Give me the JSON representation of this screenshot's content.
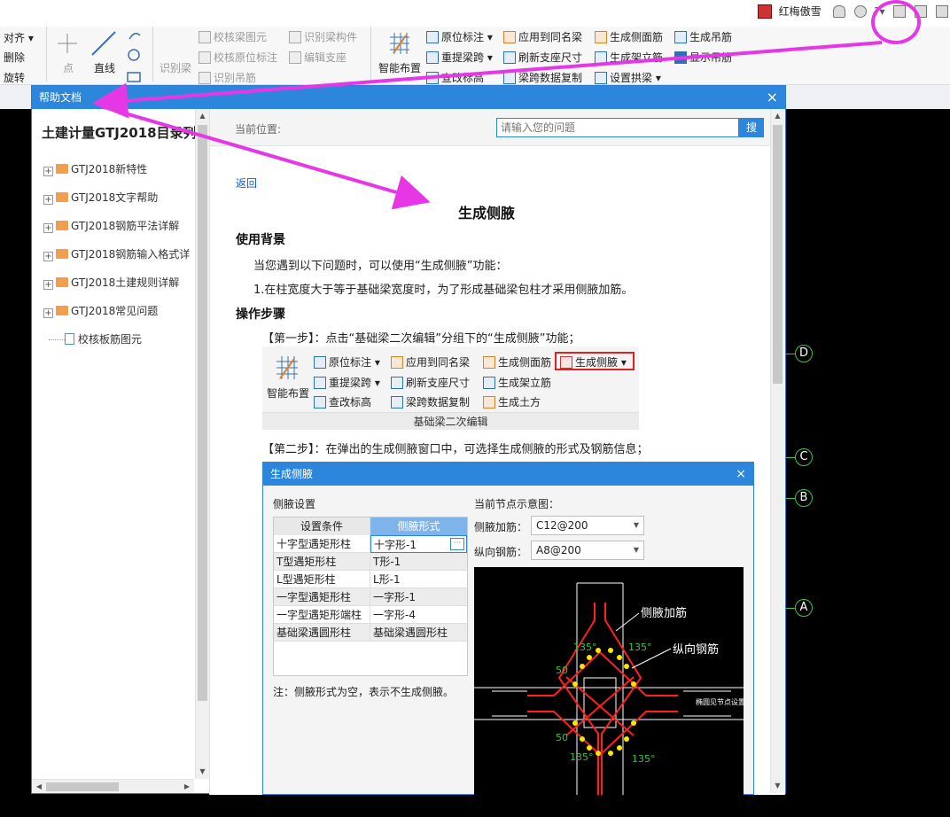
{
  "ribbon": {
    "left_items": [
      "对齐",
      "删除",
      "旋转"
    ],
    "draw_tools": {
      "point": "点",
      "line": "直线"
    },
    "identify": {
      "beam": "识别梁",
      "check_beam": "校核梁图元",
      "check_origin": "校核原位标注",
      "identify_hanger": "识别吊筋",
      "identify_beam_part": "识别梁构件",
      "edit_support": "编辑支座"
    },
    "smart_layout": "智能布置",
    "commands": {
      "origin_mark": "原位标注",
      "apply_same": "应用到同名梁",
      "gen_side": "生成侧面筋",
      "gen_hanger": "生成吊筋",
      "re_span": "重提梁跨",
      "refresh_support": "刷新支座尺寸",
      "gen_erect": "生成架立筋",
      "show_hanger": "显示吊筋",
      "change_elev": "查改标高",
      "span_copy": "梁跨数据复制",
      "set_arch": "设置拱梁"
    }
  },
  "user": {
    "name": "红梅傲雪",
    "help_icon": "question-icon"
  },
  "help_window": {
    "title": "帮助文档",
    "tree_title": "土建计量GTJ2018目录列",
    "tree": [
      {
        "label": "GTJ2018新特性",
        "type": "folder"
      },
      {
        "label": "GTJ2018文字帮助",
        "type": "folder"
      },
      {
        "label": "GTJ2018钢筋平法详解",
        "type": "folder"
      },
      {
        "label": "GTJ2018钢筋输入格式详",
        "type": "folder"
      },
      {
        "label": "GTJ2018土建规则详解",
        "type": "folder"
      },
      {
        "label": "GTJ2018常见问题",
        "type": "folder"
      },
      {
        "label": "校核板筋图元",
        "type": "doc"
      }
    ],
    "location_label": "当前位置:",
    "search_placeholder": "请输入您的问题",
    "search_button": "搜",
    "back": "返回",
    "doc": {
      "title": "生成侧腋",
      "bg_heading": "使用背景",
      "bg_intro": "当您遇到以下问题时，可以使用“生成侧腋”功能：",
      "bg_item1": "1.在柱宽度大于等于基础梁宽度时，为了形成基础梁包柱才采用侧腋加筋。",
      "steps_heading": "操作步骤",
      "step1": "【第一步】：点击“基础梁二次编辑”分组下的“生成侧腋”功能；",
      "step2": "【第二步】：在弹出的生成侧腋窗口中，可选择生成侧腋的形式及钢筋信息；"
    },
    "doc_toolbar": {
      "smart_layout": "智能布置",
      "origin_mark": "原位标注",
      "apply_same": "应用到同名梁",
      "gen_side": "生成侧面筋",
      "gen_haunch": "生成侧腋",
      "re_span": "重提梁跨",
      "refresh_support": "刷新支座尺寸",
      "gen_erect": "生成架立筋",
      "change_elev": "查改标高",
      "span_copy": "梁跨数据复制",
      "gen_earth": "生成土方",
      "group": "基础梁二次编辑"
    },
    "dialog": {
      "title": "生成侧腋",
      "section_left": "侧腋设置",
      "section_right": "当前节点示意图：",
      "col1": "设置条件",
      "col2": "侧腋形式",
      "rows": [
        {
          "cond": "十字型遇矩形柱",
          "form": "十字形-1"
        },
        {
          "cond": "T型遇矩形柱",
          "form": "T形-1"
        },
        {
          "cond": "L型遇矩形柱",
          "form": "L形-1"
        },
        {
          "cond": "一字型遇矩形柱",
          "form": "一字形-1"
        },
        {
          "cond": "一字型遇矩形端柱",
          "form": "一字形-4"
        },
        {
          "cond": "基础梁遇圆形柱",
          "form": "基础梁遇圆形柱"
        }
      ],
      "note": "注：侧腋形式为空，表示不生成侧腋。",
      "haunch_bar_label": "侧腋加筋：",
      "haunch_bar_value": "C12@200",
      "long_bar_label": "纵向钢筋：",
      "long_bar_value": "A8@200",
      "diagram": {
        "label_haunch": "侧腋加筋",
        "label_long": "纵向钢筋",
        "angle": "135°",
        "dim": "50",
        "node_note": "椭圆见节点设置"
      }
    }
  },
  "axes": [
    "D",
    "C",
    "B",
    "A"
  ],
  "colors": {
    "accent": "#2b86dc",
    "annotation": "#e637e6",
    "axis": "#3ec43e"
  }
}
